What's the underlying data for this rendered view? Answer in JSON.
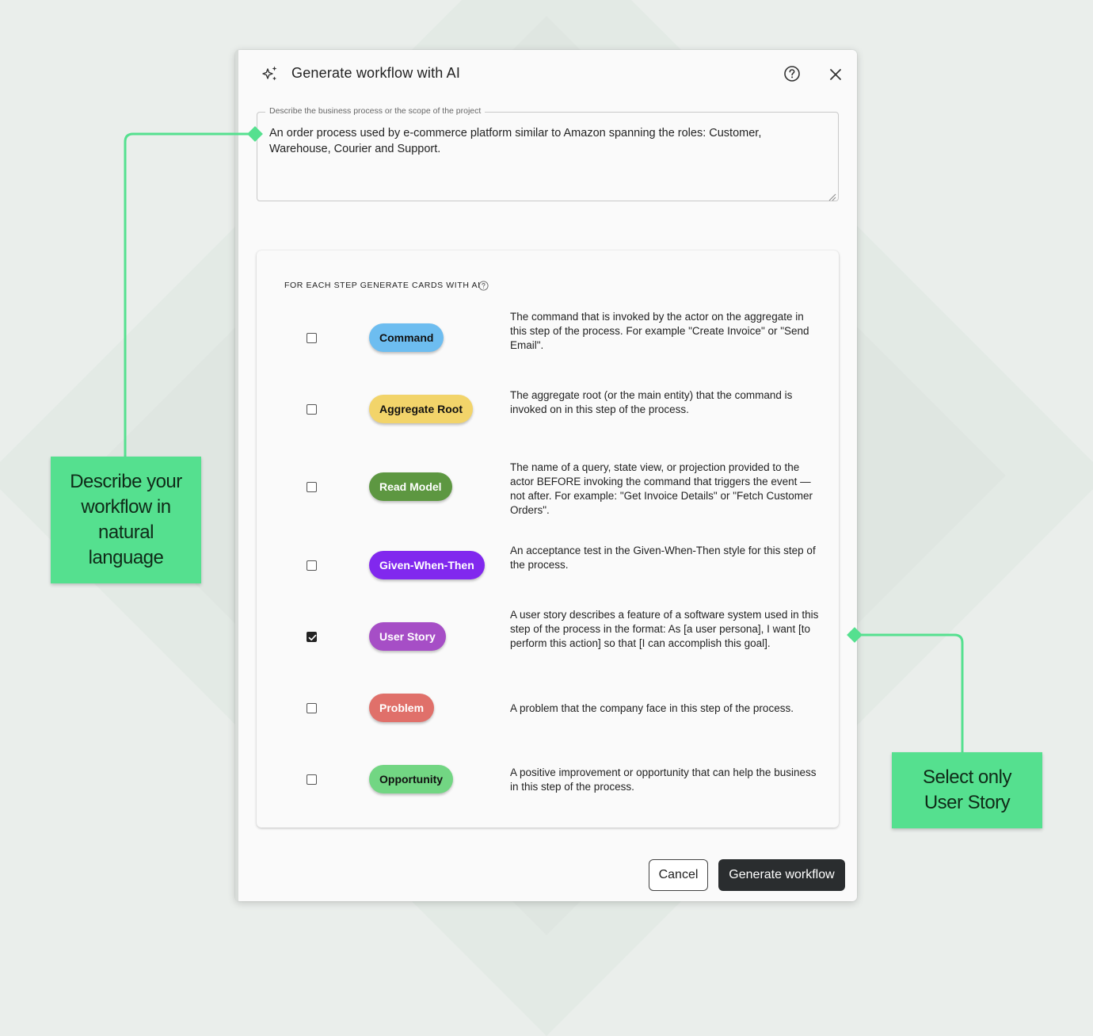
{
  "dialog": {
    "title": "Generate workflow with AI",
    "icons": {
      "title": "sparkle-icon",
      "help": "help-circle-icon",
      "close": "close-icon"
    }
  },
  "description_field": {
    "label": "Describe the business process or the scope of the project",
    "value": "An order process used by e-commerce platform similar to Amazon spanning the roles: Customer, Warehouse, Courier and Support."
  },
  "cards_section": {
    "heading": "FOR EACH STEP GENERATE CARDS WITH AI",
    "items": [
      {
        "label": "Command",
        "checked": false,
        "color": "#6dbdf0",
        "text_color": "#111111",
        "description": "The command that is invoked by the actor on the aggregate in this step of the process. For example \"Create Invoice\" or \"Send Email\"."
      },
      {
        "label": "Aggregate Root",
        "checked": false,
        "color": "#f2d46a",
        "text_color": "#111111",
        "description": "The aggregate root (or the main entity) that the command is invoked on in this step of the process."
      },
      {
        "label": "Read Model",
        "checked": false,
        "color": "#5d9741",
        "text_color": "#ffffff",
        "description": "The name of a query, state view, or projection provided to the actor BEFORE invoking the command that triggers the event — not after. For example: \"Get Invoice Details\" or \"Fetch Customer Orders\"."
      },
      {
        "label": "Given-When-Then",
        "checked": false,
        "color": "#8128ee",
        "text_color": "#ffffff",
        "description": "An acceptance test in the Given-When-Then style for this step of the process."
      },
      {
        "label": "User Story",
        "checked": true,
        "color": "#a64ec6",
        "text_color": "#ffffff",
        "description": "A user story describes a feature of a software system used in this step of the process in the format: As [a user persona], I want [to perform this action] so that [I can accomplish this goal]."
      },
      {
        "label": "Problem",
        "checked": false,
        "color": "#e0706a",
        "text_color": "#ffffff",
        "description": "A problem that the company face in this step of the process."
      },
      {
        "label": "Opportunity",
        "checked": false,
        "color": "#72d683",
        "text_color": "#111111",
        "description": "A positive improvement or opportunity that can help the business in this step of the process."
      }
    ]
  },
  "footer": {
    "cancel_label": "Cancel",
    "generate_label": "Generate workflow"
  },
  "callouts": {
    "left": "Describe your workflow in natural language",
    "right": "Select only User Story",
    "color": "#55e08f"
  }
}
